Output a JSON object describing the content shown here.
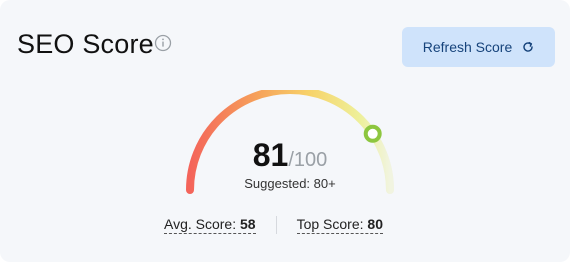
{
  "card": {
    "title": "SEO Score",
    "info_icon": "info-circle-icon",
    "refresh_button": {
      "label": "Refresh Score",
      "icon": "refresh-icon"
    }
  },
  "gauge": {
    "score": "81",
    "max": "/100",
    "score_fraction": 0.81,
    "suggested": "Suggested: 80+",
    "colors": {
      "start": "#f4645a",
      "mid": "#f7c24c",
      "end": "#ecf1c4",
      "track": "#eef0f2",
      "marker": "#8dc63f"
    }
  },
  "stats": {
    "avg_label": "Avg. Score: ",
    "avg_value": "58",
    "top_label": "Top Score: ",
    "top_value": "80"
  }
}
